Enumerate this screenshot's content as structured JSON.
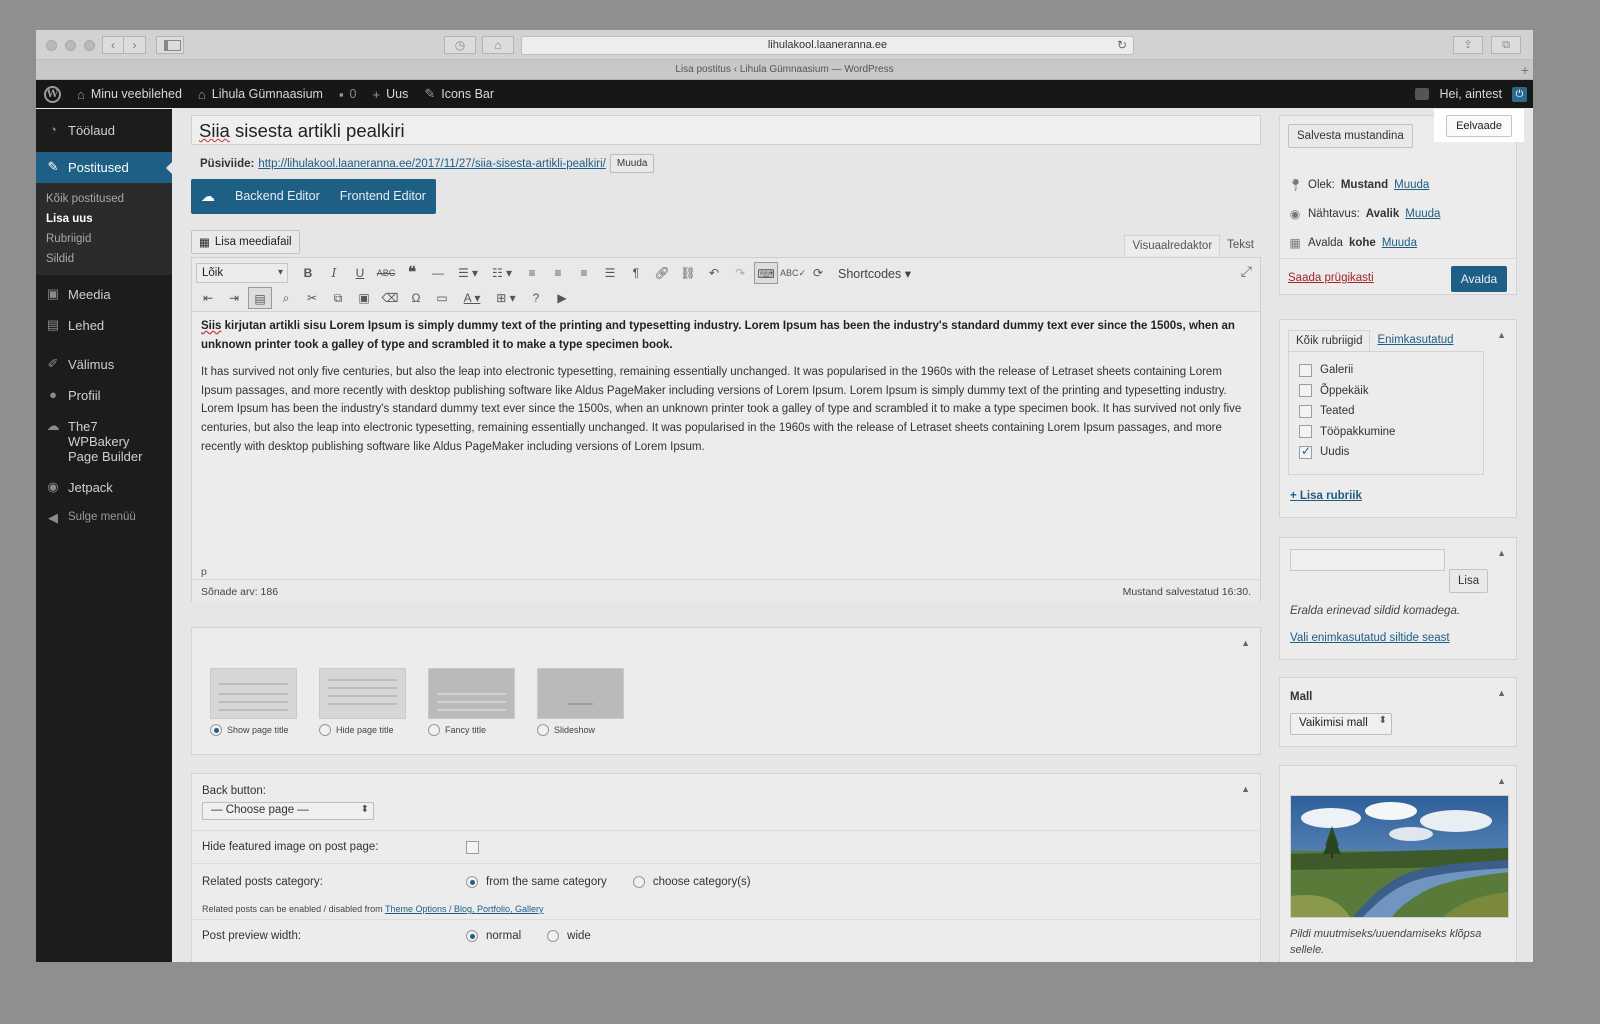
{
  "browser": {
    "url": "lihulakool.laaneranna.ee",
    "tab_title": "Lisa postitus ‹ Lihula Gümnaasium — WordPress"
  },
  "adminbar": {
    "my_sites": "Minu veebilehed",
    "site_name": "Lihula Gümnaasium",
    "comments_count": "0",
    "new_label": "Uus",
    "icons_bar": "Icons Bar",
    "greeting": "Hei, aintest"
  },
  "menu": {
    "dashboard": "Töölaud",
    "posts": "Postitused",
    "posts_sub": [
      "Kõik postitused",
      "Lisa uus",
      "Rubriigid",
      "Sildid"
    ],
    "media": "Meedia",
    "pages": "Lehed",
    "appearance": "Välimus",
    "profile": "Profiil",
    "wpbakery": "The7 WPBakery Page Builder",
    "jetpack": "Jetpack",
    "collapse": "Sulge menüü"
  },
  "post": {
    "title_word": "Siia",
    "title_rest": " sisesta artikli pealkiri",
    "permalink_label": "Püsiviide:",
    "permalink_url": "http://lihulakool.laaneranna.ee/2017/11/27/siia-sisesta-artikli-pealkiri/",
    "permalink_edit": "Muuda"
  },
  "builder": {
    "backend": "Backend Editor",
    "frontend": "Frontend Editor"
  },
  "editor": {
    "add_media": "Lisa meediafail",
    "tab_visual": "Visuaalredaktor",
    "tab_text": "Tekst",
    "format": "Lõik",
    "shortcodes": "Shortcodes",
    "bold_word": "Siis",
    "bold_rest": " kirjutan artikli sisu Lorem Ipsum is simply dummy text of the printing and typesetting industry. Lorem Ipsum has been the industry's standard dummy text ever since the 1500s, when an unknown printer took a galley of type and scrambled it to make a type specimen book.",
    "paragraph": "It has survived not only five centuries, but also the leap into electronic typesetting, remaining essentially unchanged. It was popularised in the 1960s with the release of Letraset sheets containing Lorem Ipsum passages, and more recently with desktop publishing software like Aldus PageMaker including versions of Lorem Ipsum. Lorem Ipsum is simply dummy text of the printing and typesetting industry. Lorem Ipsum has been the industry's standard dummy text ever since the 1500s, when an unknown printer took a galley of type and scrambled it to make a type specimen book. It has survived not only five centuries, but also the leap into electronic typesetting, remaining essentially unchanged. It was popularised in the 1960s with the release of Letraset sheets containing Lorem Ipsum passages, and more recently with desktop publishing software like Aldus PageMaker including versions of Lorem Ipsum.",
    "path": "p",
    "word_count": "Sõnade arv: 186",
    "draft_saved": "Mustand salvestatud 16:30."
  },
  "title_templates": [
    {
      "label": "Show page title",
      "selected": true
    },
    {
      "label": "Hide page title",
      "selected": false
    },
    {
      "label": "Fancy title",
      "selected": false
    },
    {
      "label": "Slideshow",
      "selected": false
    }
  ],
  "options": {
    "back_button_label": "Back button:",
    "back_button_value": "— Choose page —",
    "hide_featured_label": "Hide featured image on post page:",
    "related_label": "Related posts category:",
    "related_opt1": "from the same category",
    "related_opt2": "choose category(s)",
    "related_note": "Related posts can be enabled / disabled from ",
    "related_note_link": "Theme Options / Blog, Portfolio, Gallery",
    "preview_width_label": "Post preview width:",
    "preview_opt1": "normal",
    "preview_opt2": "wide"
  },
  "publish": {
    "save_draft": "Salvesta mustandina",
    "preview": "Eelvaade",
    "status_label": "Olek:",
    "status_value": "Mustand",
    "visibility_label": "Nähtavus:",
    "visibility_value": "Avalik",
    "publish_label": "Avalda",
    "publish_value": "kohe",
    "edit": "Muuda",
    "trash": "Saada prügikasti",
    "publish_button": "Avalda"
  },
  "categories": {
    "tab_all": "Kõik rubriigid",
    "tab_popular": "Enimkasutatud",
    "items": [
      {
        "label": "Galerii",
        "checked": false
      },
      {
        "label": "Õppekäik",
        "checked": false
      },
      {
        "label": "Teated",
        "checked": false
      },
      {
        "label": "Tööpakkumine",
        "checked": false
      },
      {
        "label": "Uudis",
        "checked": true
      }
    ],
    "add_new": "+ Lisa rubriik"
  },
  "tags": {
    "add_button": "Lisa",
    "hint": "Eralda erinevad sildid komadega.",
    "choose_popular": "Vali enimkasutatud siltide seast"
  },
  "template": {
    "title": "Mall",
    "value": "Vaikimisi mall"
  },
  "featured": {
    "hint": "Pildi muutmiseks/uuendamiseks klõpsa sellele."
  }
}
